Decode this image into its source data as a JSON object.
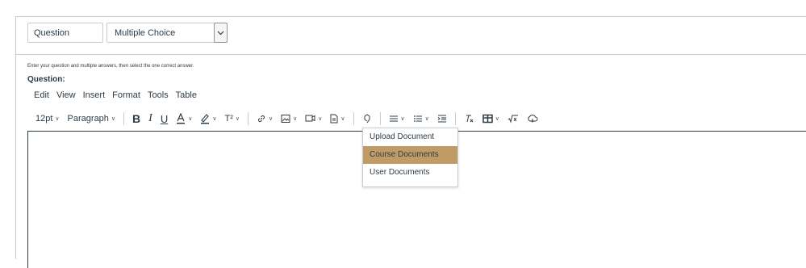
{
  "header": {
    "title_value": "Question",
    "type_selected": "Multiple Choice"
  },
  "instructions": "Enter your question and multiple answers, then select the one correct answer.",
  "question_label": "Question:",
  "menu": [
    "Edit",
    "View",
    "Insert",
    "Format",
    "Tools",
    "Table"
  ],
  "toolbar": {
    "font_size": "12pt",
    "block_format": "Paragraph",
    "bold": "B",
    "italic": "I",
    "underline": "U",
    "superscript": "T²"
  },
  "icons": {
    "text_color": "text-color-icon",
    "highlight": "highlight-icon",
    "link": "link-icon",
    "image": "image-icon",
    "media": "media-icon",
    "document": "document-icon",
    "apps": "apps-icon",
    "align": "align-icon",
    "list": "list-icon",
    "indent": "indent-icon",
    "clear_format": "clear-format-icon",
    "table": "table-icon",
    "equation": "equation-icon",
    "embed": "embed-icon"
  },
  "document_menu": [
    "Upload Document",
    "Course Documents",
    "User Documents"
  ],
  "colors": {
    "accent_highlight": "#c19b65",
    "text": "#2d3b45",
    "border": "#c7cdd1"
  }
}
